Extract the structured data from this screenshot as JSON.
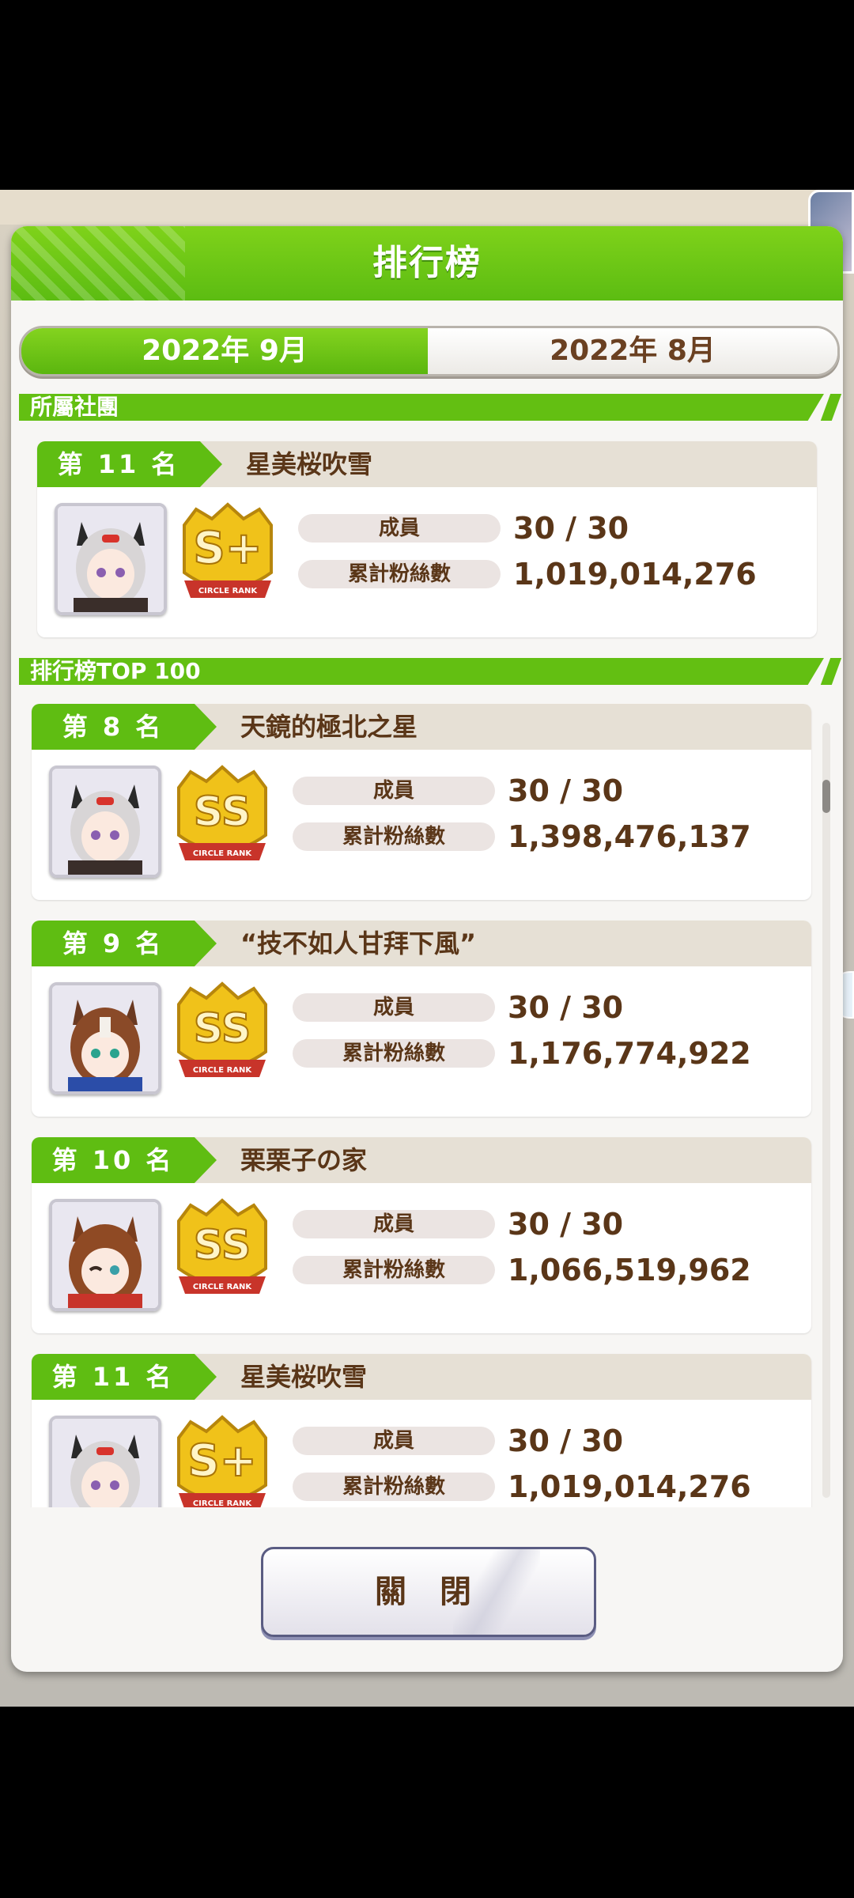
{
  "dialog": {
    "title": "排行榜",
    "close_label": "關 閉"
  },
  "tabs": {
    "active": "2022年 9月",
    "inactive": "2022年 8月"
  },
  "my_club_section": {
    "title": "所屬社團",
    "rank_label": "第 11 名",
    "name": "星美桜吹雪",
    "members_label": "成員",
    "members": "30 / 30",
    "fans_label": "累計粉絲數",
    "fans": "1,019,014,276",
    "badge": "S+",
    "badge_caption": "CIRCLE RANK"
  },
  "top_section": {
    "title": "排行榜TOP 100",
    "entries": [
      {
        "rank_label": "第 8 名",
        "name": "天鏡的極北之星",
        "members_label": "成員",
        "members": "30 / 30",
        "fans_label": "累計粉絲數",
        "fans": "1,398,476,137",
        "badge": "SS",
        "badge_caption": "CIRCLE RANK"
      },
      {
        "rank_label": "第 9 名",
        "name": "“技不如人甘拜下風”",
        "members_label": "成員",
        "members": "30 / 30",
        "fans_label": "累計粉絲數",
        "fans": "1,176,774,922",
        "badge": "SS",
        "badge_caption": "CIRCLE RANK"
      },
      {
        "rank_label": "第 10 名",
        "name": "栗栗子の家",
        "members_label": "成員",
        "members": "30 / 30",
        "fans_label": "累計粉絲數",
        "fans": "1,066,519,962",
        "badge": "SS",
        "badge_caption": "CIRCLE RANK"
      },
      {
        "rank_label": "第 11 名",
        "name": "星美桜吹雪",
        "members_label": "成員",
        "members": "30 / 30",
        "fans_label": "累計粉絲數",
        "fans": "1,019,014,276",
        "badge": "S+",
        "badge_caption": "CIRCLE RANK"
      }
    ]
  },
  "colors": {
    "accent_green": "#5fbd12",
    "text_brown": "#5a3618",
    "badge_gold": "#f0c21a",
    "badge_red": "#c8342a"
  }
}
